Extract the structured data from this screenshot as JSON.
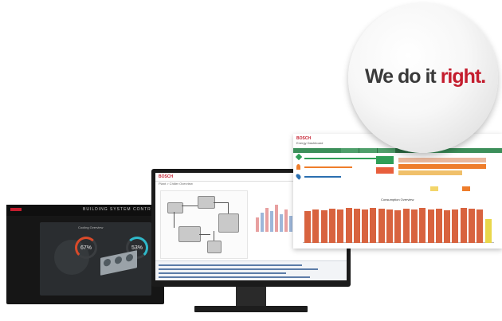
{
  "badge": {
    "slogan_main": "We do it ",
    "slogan_accent": "right."
  },
  "left_monitor": {
    "title": "BUILDING SYSTEM CONTROL",
    "panel_title": "Cooling Overview",
    "gauge_left_value": "67%",
    "gauge_right_value": "53%"
  },
  "center_monitor": {
    "brand": "BOSCH",
    "breadcrumb": "Plant > Chiller Overview"
  },
  "right_screen": {
    "brand": "BOSCH",
    "title": "Energy Dashboard",
    "chart_title": "Consumption Overview"
  },
  "colors": {
    "brand_red": "#c41d2e",
    "green": "#3c8f5a",
    "bar_orange": "#d8633f"
  }
}
